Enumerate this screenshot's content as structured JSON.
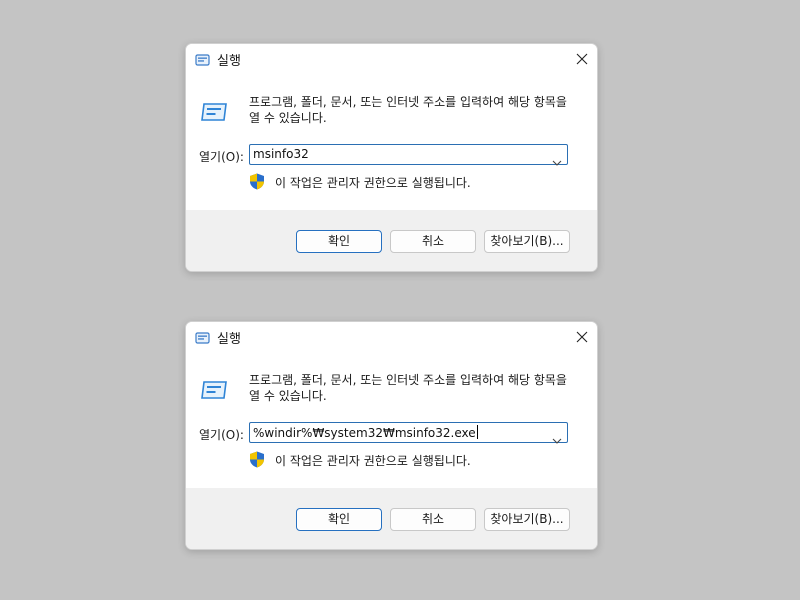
{
  "dialogs": [
    {
      "title": "실행",
      "description": "프로그램, 폴더, 문서, 또는 인터넷 주소를 입력하여 해당 항목을 열 수 있습니다.",
      "open_label": "열기(O):",
      "input_value": "msinfo32",
      "admin_note": "이 작업은 관리자 권한으로 실행됩니다.",
      "buttons": {
        "ok": "확인",
        "cancel": "취소",
        "browse": "찾아보기(B)..."
      }
    },
    {
      "title": "실행",
      "description": "프로그램, 폴더, 문서, 또는 인터넷 주소를 입력하여 해당 항목을 열 수 있습니다.",
      "open_label": "열기(O):",
      "input_value": "%windir%₩system32₩msinfo32.exe",
      "admin_note": "이 작업은 관리자 권한으로 실행됩니다.",
      "buttons": {
        "ok": "확인",
        "cancel": "취소",
        "browse": "찾아보기(B)..."
      }
    }
  ],
  "icons": {
    "title": "run-icon",
    "close": "close-icon",
    "large": "run-icon",
    "combo": "chevron-down-icon",
    "admin": "shield-icon"
  },
  "colors": {
    "accent": "#2670c0",
    "background": "#c4c4c4",
    "footer": "#f0f0f0"
  }
}
